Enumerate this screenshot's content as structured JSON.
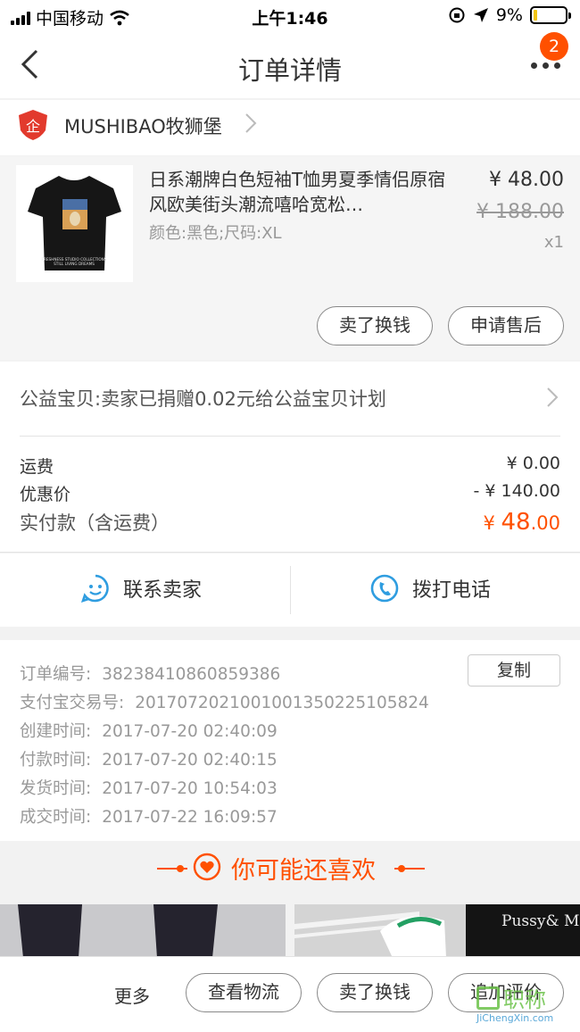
{
  "status_bar": {
    "carrier": "中国移动",
    "time": "上午1:46",
    "battery": "9%",
    "battery_level": 0.09
  },
  "nav": {
    "title": "订单详情",
    "badge_count": "2"
  },
  "shop": {
    "name": "MUSHIBAO牧狮堡"
  },
  "product": {
    "title": "日系潮牌白色短袖T恤男夏季情侣原宿风欧美街头潮流嘻哈宽松…",
    "spec": "颜色:黑色;尺码:XL",
    "price": "¥ 48.00",
    "original_price": "¥ 188.00",
    "quantity": "x1",
    "thumb_text": [
      "FRESHNESS STUDIO COLLECTIONS",
      "STILL LIVING DREAMS"
    ],
    "buttons": {
      "sell": "卖了换钱",
      "after_sale": "申请售后"
    }
  },
  "charity": {
    "text": "公益宝贝:卖家已捐赠0.02元给公益宝贝计划"
  },
  "fees": {
    "shipping_label": "运费",
    "shipping_value": "¥ 0.00",
    "discount_label": "优惠价",
    "discount_value": "- ¥ 140.00",
    "total_label": "实付款（含运费）",
    "total_currency": "¥",
    "total_main": "48",
    "total_decimal": ".00"
  },
  "contact": {
    "seller": "联系卖家",
    "phone": "拨打电话"
  },
  "order_info": {
    "copy_label": "复制",
    "rows": [
      {
        "label": "订单编号:",
        "value": "38238410860859386"
      },
      {
        "label": "支付宝交易号:",
        "value": "2017072021001001350225105824"
      },
      {
        "label": "创建时间:",
        "value": "2017-07-20 02:40:09"
      },
      {
        "label": "付款时间:",
        "value": "2017-07-20 02:40:15"
      },
      {
        "label": "发货时间:",
        "value": "2017-07-20 10:54:03"
      },
      {
        "label": "成交时间:",
        "value": "2017-07-22 16:09:57"
      }
    ]
  },
  "recommend": {
    "title": "你可能还喜欢",
    "image_text": "Pussy& Money& Weed"
  },
  "bottom_bar": {
    "more": "更多",
    "logistics": "查看物流",
    "sell": "卖了换钱",
    "review": "追加评价"
  },
  "watermark": {
    "brand": "职称",
    "url": "JiChengXin.com"
  },
  "colors": {
    "accent": "#ff5000",
    "text": "#333333",
    "muted": "#999999"
  }
}
